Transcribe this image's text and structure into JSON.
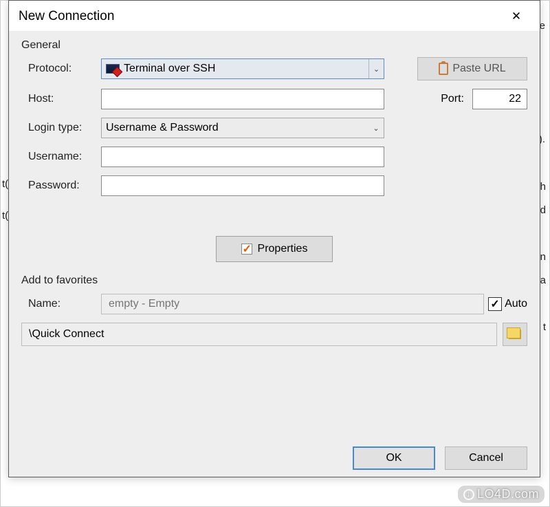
{
  "dialog": {
    "title": "New Connection",
    "close_aria": "Close"
  },
  "general": {
    "group": "General",
    "protocol_label": "Protocol:",
    "protocol_value": "Terminal over SSH",
    "paste_url": "Paste URL",
    "host_label": "Host:",
    "host_value": "",
    "port_label": "Port:",
    "port_value": "22",
    "login_type_label": "Login type:",
    "login_type_value": "Username & Password",
    "username_label": "Username:",
    "username_value": "",
    "password_label": "Password:",
    "password_value": "",
    "properties_btn": "Properties"
  },
  "favorites": {
    "group": "Add to favorites",
    "name_label": "Name:",
    "name_placeholder": "empty - Empty",
    "auto_label": "Auto",
    "auto_checked": true,
    "path_value": "\\Quick Connect"
  },
  "buttons": {
    "ok": "OK",
    "cancel": "Cancel"
  },
  "watermark": "LO4D.com"
}
